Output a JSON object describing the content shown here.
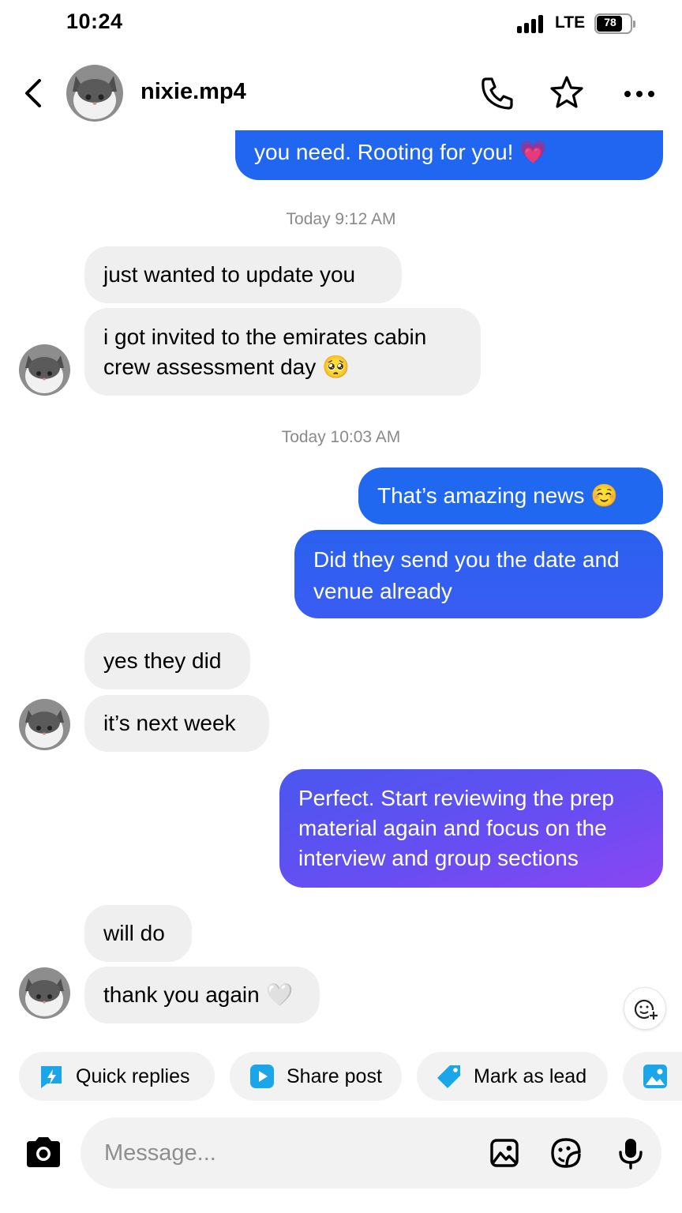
{
  "status_bar": {
    "time": "10:24",
    "network": "LTE",
    "battery": "78"
  },
  "header": {
    "username": "nixie.mp4"
  },
  "messages": {
    "m0": "you need. Rooting for you! 💗",
    "ts1": "Today 9:12 AM",
    "m1": "just wanted to update you",
    "m2_line1": "i got invited to the emirates cabin",
    "m2_line2": "crew assessment day 🥺",
    "ts2": "Today 10:03 AM",
    "m3": "That’s amazing news ☺️",
    "m4_line1": "Did they send you the date and",
    "m4_line2": "venue already",
    "m5": "yes they did",
    "m6": "it’s next week",
    "m7_line1": "Perfect. Start reviewing the prep",
    "m7_line2": "material again and focus on the",
    "m7_line3": "interview and group sections",
    "m8": "will do",
    "m9": "thank you again 🤍"
  },
  "quick_actions": [
    {
      "label": "Quick replies",
      "icon": "lightning-bubble-icon"
    },
    {
      "label": "Share post",
      "icon": "play-square-icon"
    },
    {
      "label": "Mark as lead",
      "icon": "tag-icon"
    },
    {
      "label": "",
      "icon": "image-icon"
    }
  ],
  "composer": {
    "placeholder": "Message..."
  },
  "colors": {
    "outgoing_start": "#1f6bf2",
    "outgoing_end": "#8a45f2",
    "incoming": "#efefef",
    "accent_icon": "#1aa6e8"
  }
}
